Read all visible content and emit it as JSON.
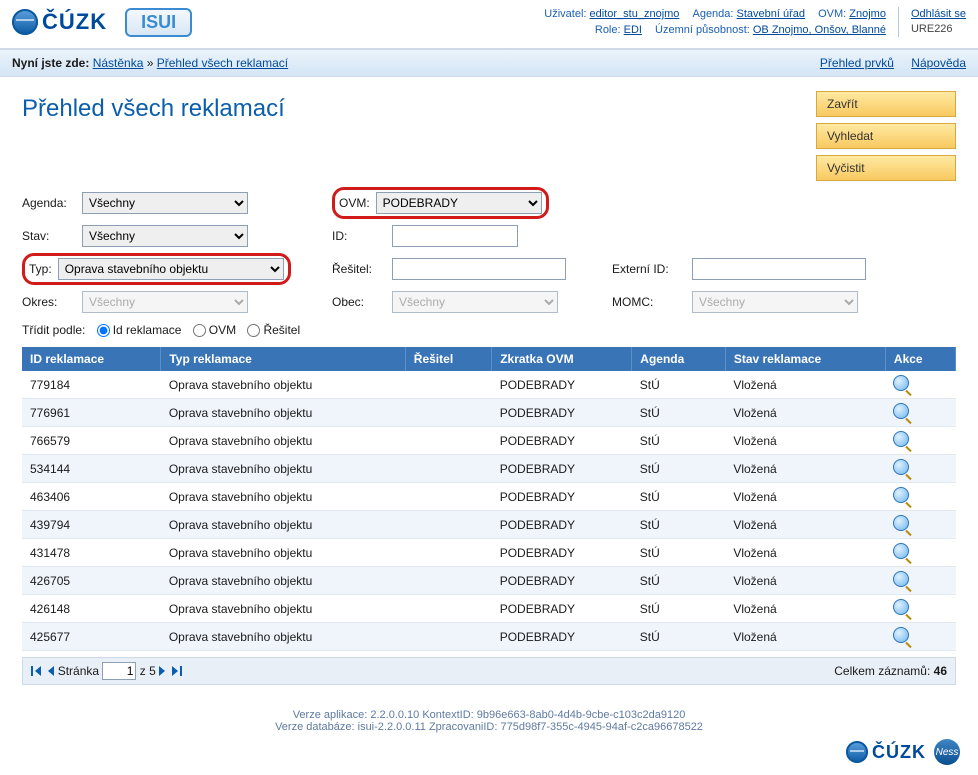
{
  "header": {
    "info_line1": {
      "user_label": "Uživatel:",
      "user": "editor_stu_znojmo",
      "agenda_label": "Agenda:",
      "agenda": "Stavební úřad",
      "ovm_label": "OVM:",
      "ovm": "Znojmo"
    },
    "info_line2": {
      "role_label": "Role:",
      "role": "EDI",
      "region_label": "Územní působnost:",
      "region": "OB Znojmo, Onšov, Blanné"
    },
    "logout": "Odhlásit se",
    "app_id": "URE226",
    "logo_cuzk": "ČÚZK",
    "logo_isui": "ISUI"
  },
  "breadcrumb": {
    "prefix": "Nyní jste zde:",
    "items": [
      "Nástěnka",
      "Přehled všech reklamací"
    ],
    "links": {
      "prvku": "Přehled prvků",
      "napoveda": "Nápověda"
    }
  },
  "page_title": "Přehled všech reklamací",
  "actions": {
    "close": "Zavřít",
    "search": "Vyhledat",
    "clear": "Vyčistit"
  },
  "filters": {
    "agenda": {
      "label": "Agenda:",
      "value": "Všechny"
    },
    "ovm": {
      "label": "OVM:",
      "value": "PODEBRADY"
    },
    "stav": {
      "label": "Stav:",
      "value": "Všechny"
    },
    "id": {
      "label": "ID:",
      "value": ""
    },
    "typ": {
      "label": "Typ:",
      "value": "Oprava stavebního objektu"
    },
    "resitel": {
      "label": "Řešitel:",
      "value": ""
    },
    "externi": {
      "label": "Externí ID:",
      "value": ""
    },
    "okres": {
      "label": "Okres:",
      "value": "Všechny"
    },
    "obec": {
      "label": "Obec:",
      "value": "Všechny"
    },
    "momc": {
      "label": "MOMC:",
      "value": "Všechny"
    }
  },
  "sort": {
    "label": "Třídit podle:",
    "options": {
      "id": "Id reklamace",
      "ovm": "OVM",
      "resitel": "Řešitel"
    },
    "selected": "id"
  },
  "table": {
    "columns": [
      "ID reklamace",
      "Typ reklamace",
      "Řešitel",
      "Zkratka OVM",
      "Agenda",
      "Stav reklamace",
      "Akce"
    ],
    "rows": [
      {
        "id": "779184",
        "typ": "Oprava stavebního objektu",
        "resitel": "",
        "ovm": "PODEBRADY",
        "agenda": "StÚ",
        "stav": "Vložená"
      },
      {
        "id": "776961",
        "typ": "Oprava stavebního objektu",
        "resitel": "",
        "ovm": "PODEBRADY",
        "agenda": "StÚ",
        "stav": "Vložená"
      },
      {
        "id": "766579",
        "typ": "Oprava stavebního objektu",
        "resitel": "",
        "ovm": "PODEBRADY",
        "agenda": "StÚ",
        "stav": "Vložená"
      },
      {
        "id": "534144",
        "typ": "Oprava stavebního objektu",
        "resitel": "",
        "ovm": "PODEBRADY",
        "agenda": "StÚ",
        "stav": "Vložená"
      },
      {
        "id": "463406",
        "typ": "Oprava stavebního objektu",
        "resitel": "",
        "ovm": "PODEBRADY",
        "agenda": "StÚ",
        "stav": "Vložená"
      },
      {
        "id": "439794",
        "typ": "Oprava stavebního objektu",
        "resitel": "",
        "ovm": "PODEBRADY",
        "agenda": "StÚ",
        "stav": "Vložená"
      },
      {
        "id": "431478",
        "typ": "Oprava stavebního objektu",
        "resitel": "",
        "ovm": "PODEBRADY",
        "agenda": "StÚ",
        "stav": "Vložená"
      },
      {
        "id": "426705",
        "typ": "Oprava stavebního objektu",
        "resitel": "",
        "ovm": "PODEBRADY",
        "agenda": "StÚ",
        "stav": "Vložená"
      },
      {
        "id": "426148",
        "typ": "Oprava stavebního objektu",
        "resitel": "",
        "ovm": "PODEBRADY",
        "agenda": "StÚ",
        "stav": "Vložená"
      },
      {
        "id": "425677",
        "typ": "Oprava stavebního objektu",
        "resitel": "",
        "ovm": "PODEBRADY",
        "agenda": "StÚ",
        "stav": "Vložená"
      }
    ]
  },
  "pager": {
    "label": "Stránka",
    "page": "1",
    "sep": "z",
    "total_pages": "5",
    "total_label": "Celkem záznamů:",
    "total": "46"
  },
  "footer": {
    "line1": "Verze aplikace: 2.2.0.0.10 KontextID: 9b96e663-8ab0-4d4b-9cbe-c103c2da9120",
    "line2": "Verze databáze: isui-2.2.0.0.11 ZpracovaniID: 775d98f7-355c-4945-94af-c2ca96678522",
    "ness": "Ness"
  }
}
